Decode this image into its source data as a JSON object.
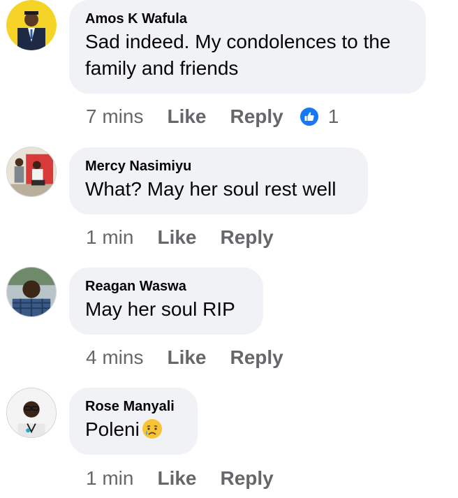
{
  "comments": [
    {
      "author": "Amos K Wafula",
      "text_line1": "Sad indeed. My condolences to the",
      "text_line2": "family and friends",
      "time": "7 mins",
      "like_label": "Like",
      "reply_label": "Reply",
      "reaction_icon": "like-thumb-icon",
      "reaction_count": "1"
    },
    {
      "author": "Mercy Nasimiyu",
      "text": "What? May her soul rest well",
      "time": "1 min",
      "like_label": "Like",
      "reply_label": "Reply"
    },
    {
      "author": "Reagan Waswa",
      "text": "May her soul RIP",
      "time": "4 mins",
      "like_label": "Like",
      "reply_label": "Reply"
    },
    {
      "author": "Rose Manyali",
      "text": "Poleni",
      "emoji": "crying-face-emoji",
      "time": "1 min",
      "like_label": "Like",
      "reply_label": "Reply"
    }
  ],
  "colors": {
    "bubble_bg": "#f0f2f5",
    "text": "#050505",
    "secondary_text": "#65676b",
    "reaction_blue": "#1877f2",
    "avatar_ring_yellow": "#f5d327"
  }
}
